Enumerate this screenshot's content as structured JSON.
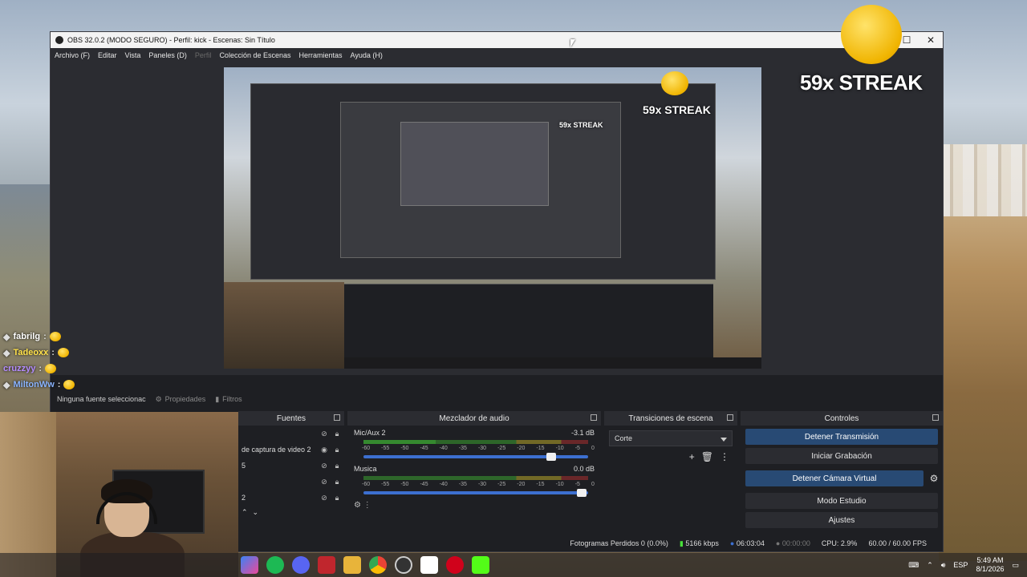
{
  "window": {
    "title": "OBS 32.0.2 (MODO SEGURO) - Perfil: kick - Escenas: Sin Título",
    "minimize": "—",
    "maximize": "☐",
    "close": "✕"
  },
  "menu": [
    {
      "label": "Archivo (F)"
    },
    {
      "label": "Editar"
    },
    {
      "label": "Vista"
    },
    {
      "label": "Paneles (D)"
    },
    {
      "label": "Perfil"
    },
    {
      "label": "Colección de Escenas"
    },
    {
      "label": "Herramientas"
    },
    {
      "label": "Ayuda (H)"
    }
  ],
  "overlay": {
    "streak_text": "59x STREAK"
  },
  "chat": [
    {
      "user": "fabrilg",
      "color": "#ffffff"
    },
    {
      "user": "Tadeoxx",
      "color": "#ffe14a"
    },
    {
      "user": "cruzzyy",
      "color": "#b48cff"
    },
    {
      "user": "MiltonWw",
      "color": "#8ab4ff"
    }
  ],
  "source_toolbar": {
    "no_source": "Ninguna fuente seleccionac",
    "properties": "Propiedades",
    "filters": "Filtros"
  },
  "docks": {
    "fuentes": {
      "title": "Fuentes",
      "items": [
        {
          "name": ""
        },
        {
          "name": "de captura de video 2"
        },
        {
          "name": "5"
        },
        {
          "name": ""
        },
        {
          "name": "2"
        },
        {
          "name": ""
        }
      ]
    },
    "mezclador": {
      "title": "Mezclador de audio",
      "channels": [
        {
          "name": "Mic/Aux 2",
          "db": "-3.1 dB",
          "level": 0.32
        },
        {
          "name": "Musica",
          "db": "0.0 dB",
          "level": 0.0
        }
      ],
      "scale": [
        "-60",
        "-55",
        "-50",
        "-45",
        "-40",
        "-35",
        "-30",
        "-25",
        "-20",
        "-15",
        "-10",
        "-5",
        "0"
      ]
    },
    "transiciones": {
      "title": "Transiciones de escena",
      "selected": "Corte"
    },
    "controles": {
      "title": "Controles",
      "buttons": [
        {
          "label": "Detener Transmisión",
          "active": true
        },
        {
          "label": "Iniciar Grabación",
          "active": false
        },
        {
          "label": "Detener Cámara Virtual",
          "active": true
        },
        {
          "label": "Modo Estudio",
          "active": false
        },
        {
          "label": "Ajustes",
          "active": false
        }
      ]
    }
  },
  "status": {
    "dropped_frames": "Fotogramas Perdidos 0 (0.0%)",
    "bitrate": "5166 kbps",
    "stream_time": "06:03:04",
    "rec_time": "00:00:00",
    "cpu": "CPU: 2.9%",
    "fps": "60.00 / 60.00 FPS"
  },
  "taskbar": {
    "lang": "ESP",
    "time": "5:49 AM",
    "date": "8/1/2026"
  },
  "colors": {
    "accent_active": "#284a74",
    "meter_green": "#48e03a"
  }
}
